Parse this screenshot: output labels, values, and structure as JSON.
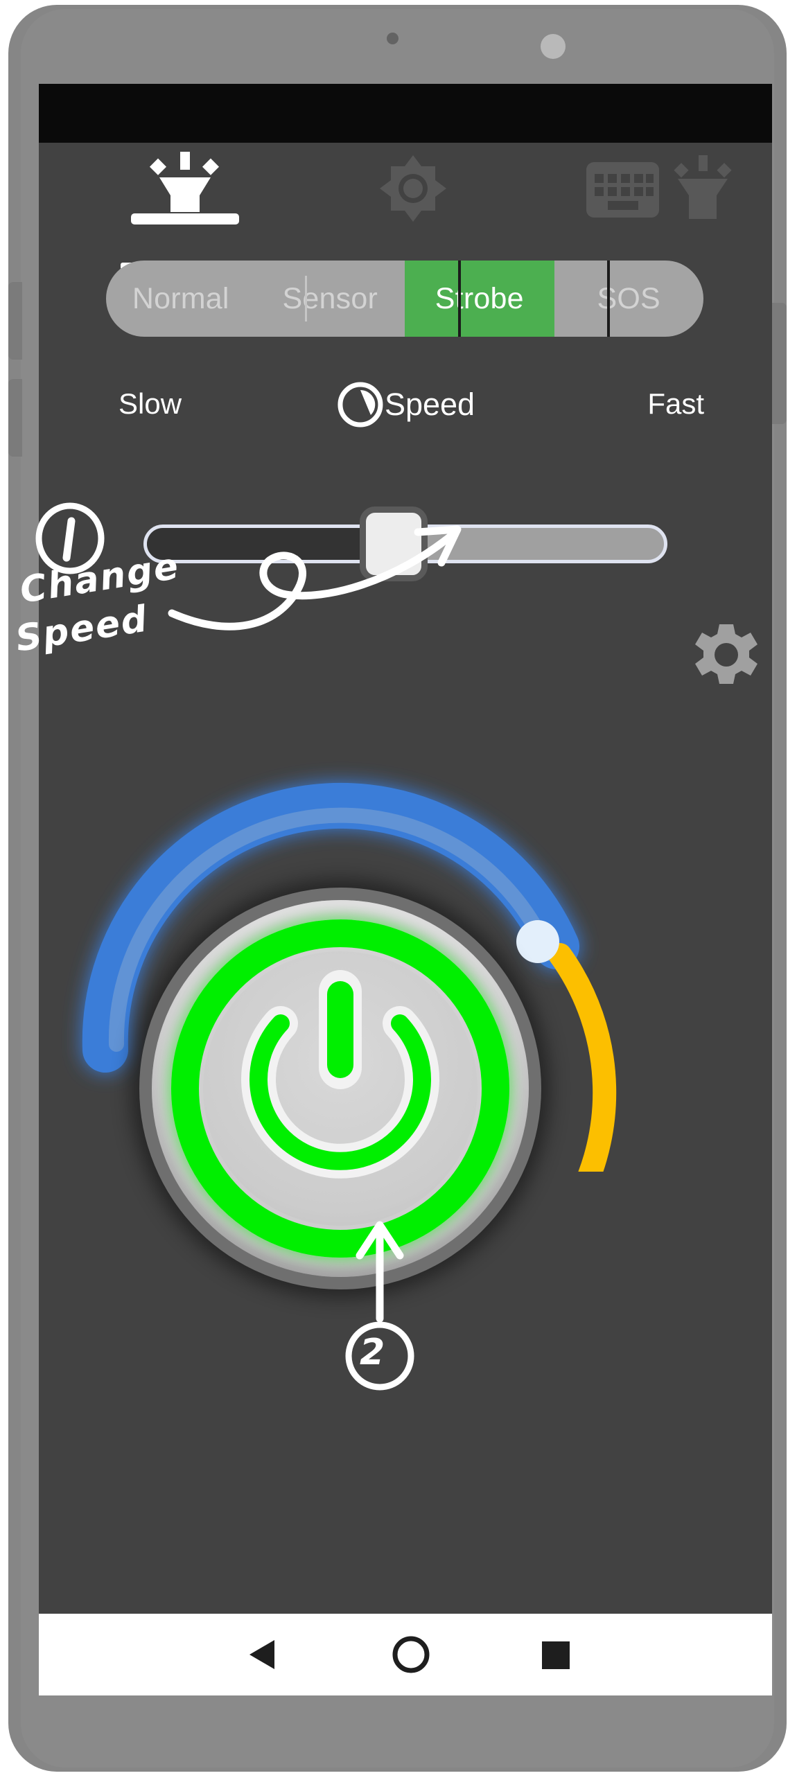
{
  "app": {
    "name": "Flashlight",
    "screen_bg": "#424242",
    "accent_green": "#4CAF50",
    "ring_green": "#00EF00",
    "arc_blue": "#3B7DD8",
    "arc_yellow": "#FCBF00",
    "dot_light_blue": "#E3EFFB"
  },
  "status_bar": {
    "background": "#0A0A0A"
  },
  "top_tabs": [
    {
      "id": "flashlight",
      "icon": "flashlight-icon",
      "active": true
    },
    {
      "id": "brightness",
      "icon": "brightness-sun-icon",
      "active": false
    },
    {
      "id": "keyboard",
      "icon": "keyboard-icon",
      "active": false
    },
    {
      "id": "flashlight-alt",
      "icon": "flashlight-icon",
      "active": false
    }
  ],
  "modes": {
    "items": [
      {
        "label": "Normal",
        "selected": false
      },
      {
        "label": "Sensor",
        "selected": false
      },
      {
        "label": "Strobe",
        "selected": true
      },
      {
        "label": "SOS",
        "selected": false
      }
    ]
  },
  "speed": {
    "icon": "speed-clock-icon",
    "label": "Speed",
    "min_label": "Slow",
    "max_label": "Fast",
    "value_percent": 52
  },
  "settings": {
    "icon": "gear-icon"
  },
  "power": {
    "icon": "power-icon",
    "state_on": true,
    "blue_arc_label": "",
    "yellow_arc_label": ""
  },
  "annotations": [
    {
      "id": "1",
      "marker": "①",
      "line1": "Change",
      "line2": "Speed",
      "points_to": "speed-slider-thumb"
    },
    {
      "id": "2",
      "marker": "②",
      "line1": "",
      "line2": "",
      "points_to": "power-button"
    }
  ],
  "nav_bar": {
    "items": [
      {
        "id": "back",
        "icon": "back-triangle-icon"
      },
      {
        "id": "home",
        "icon": "home-circle-icon"
      },
      {
        "id": "recent",
        "icon": "recents-square-icon"
      }
    ]
  }
}
